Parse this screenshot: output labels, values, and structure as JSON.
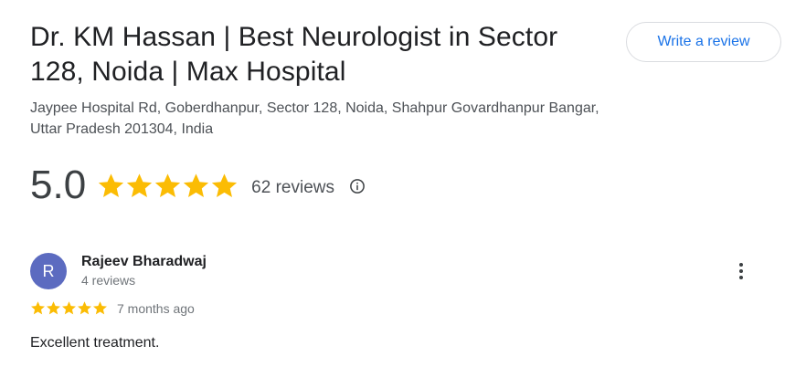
{
  "business": {
    "title": "Dr. KM Hassan | Best Neurologist in Sector 128, Noida | Max Hospital",
    "address": "Jaypee Hospital Rd, Goberdhanpur, Sector 128, Noida, Shahpur Govardhanpur Bangar, Uttar Pradesh 201304, India"
  },
  "actions": {
    "write_review_label": "Write a review"
  },
  "rating": {
    "score": "5.0",
    "stars": 5,
    "review_count_label": "62 reviews",
    "star_color": "#fbbc04"
  },
  "review": {
    "avatar_initial": "R",
    "avatar_color": "#5c6bc0",
    "reviewer_name": "Rajeev Bharadwaj",
    "reviewer_meta": "4 reviews",
    "stars": 5,
    "time": "7 months ago",
    "text": "Excellent treatment."
  },
  "icons": {
    "info": "info-icon",
    "more": "more-vert-icon",
    "star": "star-icon"
  }
}
